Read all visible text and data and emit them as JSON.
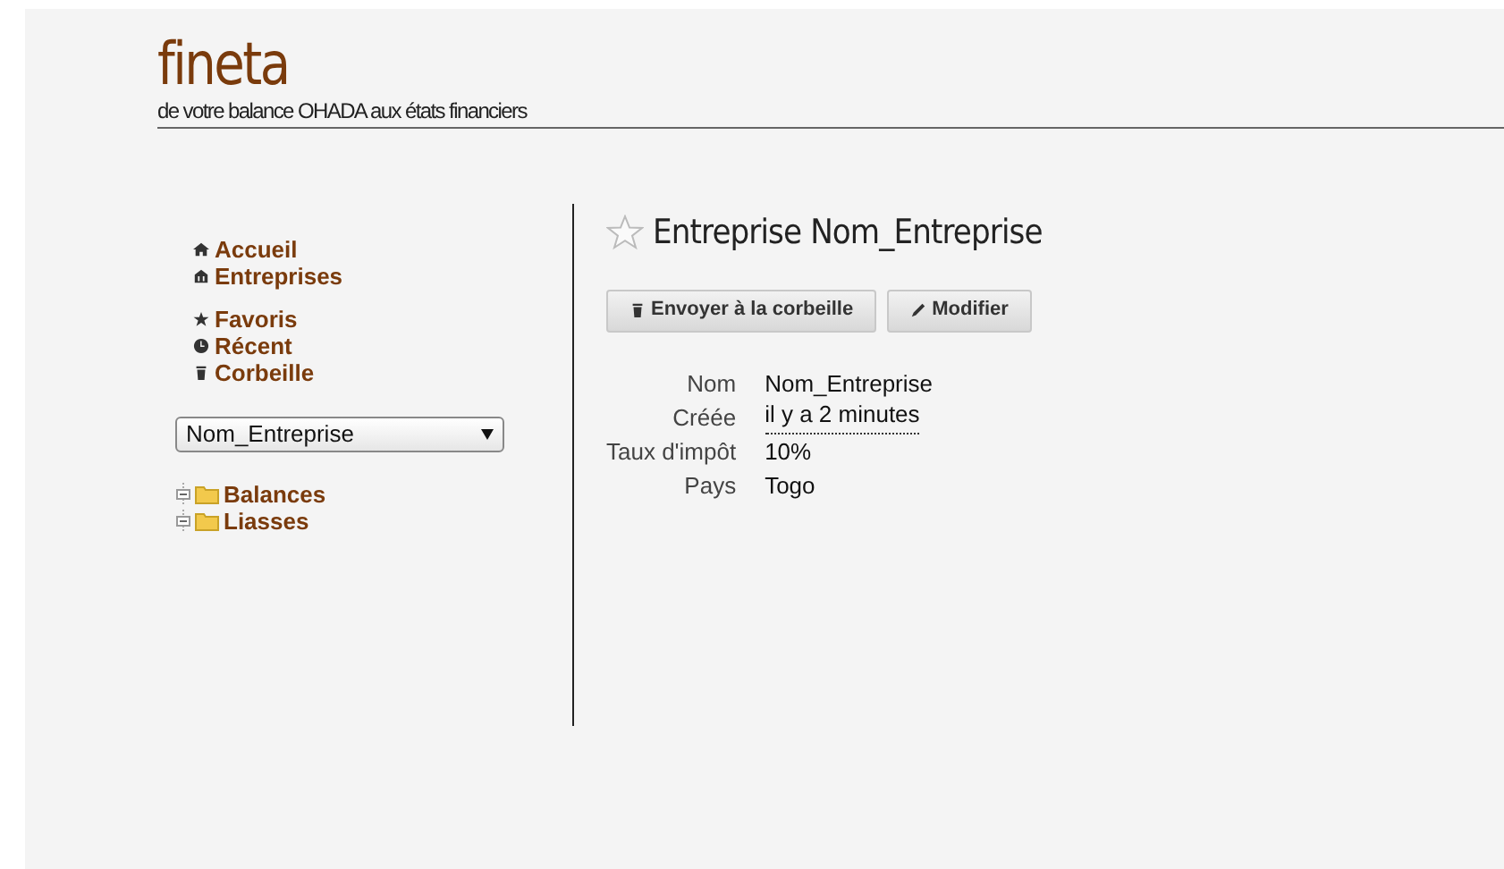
{
  "header": {
    "logo": "fineta",
    "tagline": "de votre balance OHADA aux états financiers"
  },
  "sidebar": {
    "nav_groups": [
      [
        {
          "label": "Accueil",
          "kind": "home"
        },
        {
          "label": "Entreprises",
          "kind": "building"
        }
      ],
      [
        {
          "label": "Favoris",
          "kind": "star"
        },
        {
          "label": "Récent",
          "kind": "clock"
        },
        {
          "label": "Corbeille",
          "kind": "trash"
        }
      ]
    ],
    "company_select": {
      "value": "Nom_Entreprise"
    },
    "tree": [
      {
        "label": "Balances"
      },
      {
        "label": "Liasses"
      }
    ]
  },
  "main": {
    "title": "Entreprise Nom_Entreprise",
    "favorite": false,
    "buttons": [
      {
        "label": "Envoyer à la corbeille",
        "kind": "trash"
      },
      {
        "label": "Modifier",
        "kind": "pencil"
      }
    ],
    "details": [
      {
        "label": "Nom",
        "value": "Nom_Entreprise",
        "kind": "text"
      },
      {
        "label": "Créée",
        "value": "il y a 2 minutes",
        "kind": "time"
      },
      {
        "label": "Taux d'impôt",
        "value": "10%",
        "kind": "text"
      },
      {
        "label": "Pays",
        "value": "Togo",
        "kind": "text"
      }
    ]
  }
}
